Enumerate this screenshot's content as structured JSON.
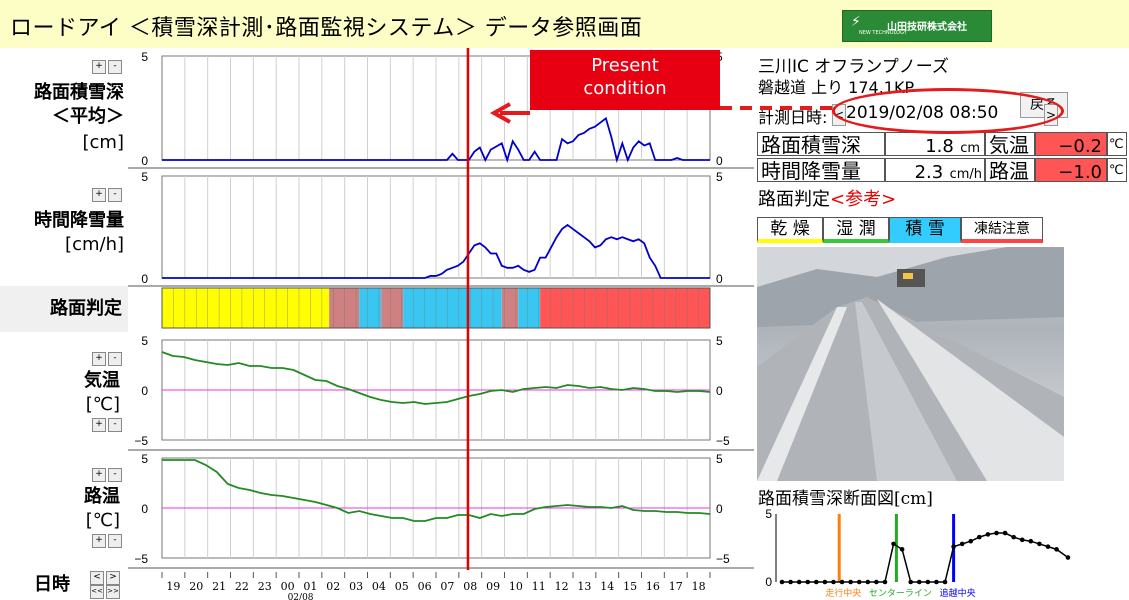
{
  "header": {
    "title": "ロードアイ ＜積雪深計測･路面監視システム＞ データ参照画面",
    "logo_text": "山田技研株式会社",
    "logo_sub": "NEW TECHNOLOGY"
  },
  "annotation": {
    "line1": "Present",
    "line2": "condition"
  },
  "labels": {
    "snow_depth_1": "路面積雪深",
    "snow_depth_2": "＜平均＞",
    "snow_depth_unit": "[cm]",
    "snowfall_1": "時間降雪量",
    "snowfall_unit": "[cm/h]",
    "surface_state": "路面判定",
    "air_temp_1": "気温",
    "air_temp_unit": "[℃]",
    "road_temp_1": "路温",
    "road_temp_unit": "[℃]",
    "datetime": "日時",
    "plus": "+",
    "minus": "-",
    "nav_prev": "<",
    "nav_next": ">",
    "nav_prev2": "<<",
    "nav_next2": ">>"
  },
  "right": {
    "location_1": "三川IC オフランプノーズ",
    "location_2": "磐越道 上り 174.1KP",
    "back_label": "戻る",
    "measure_label": "計測日時:",
    "prev_btn": "<",
    "next_btn": ">",
    "datetime": "2019/02/08 08:50",
    "snow_depth_label": "路面積雪深",
    "snow_depth_value": "1.8",
    "snow_depth_unit": "cm",
    "air_temp_label": "気温",
    "air_temp_value": "−0.2",
    "temp_unit": "℃",
    "snowfall_label": "時間降雪量",
    "snowfall_value": "2.3",
    "snowfall_unit": "cm/h",
    "road_temp_label": "路温",
    "road_temp_value": "−1.0",
    "surface_title": "路面判定",
    "surface_ref": "<参考>",
    "states": [
      {
        "label": "乾 燥",
        "color": "#ffff00"
      },
      {
        "label": "湿 潤",
        "color": "#39c83a"
      },
      {
        "label": "積 雪",
        "color": "#33ccff"
      },
      {
        "label": "凍結注意",
        "color": "#ff4444"
      }
    ],
    "cross_section_title": "路面積雪深断面図[cm]",
    "cs_labels": [
      "走行中央",
      "センターライン",
      "追越中央"
    ]
  },
  "colors": {
    "line_blue": "#0000cc",
    "line_green": "#228b22",
    "zero_magenta": "#ee33ee",
    "present_red": "#e00000",
    "state_yellow": "#ffff00",
    "state_blue": "#39c7f2",
    "state_red": "#ff5555",
    "state_mix": "#cf8080"
  },
  "chart_data": [
    {
      "type": "line",
      "name": "snow_depth",
      "ylim": [
        0,
        5
      ],
      "yticks": [
        0,
        5
      ],
      "x": [
        0,
        52,
        53,
        54,
        55,
        56,
        57,
        58,
        59,
        60,
        62,
        63,
        64,
        65,
        66,
        67,
        68,
        69,
        70,
        72,
        73,
        74,
        75,
        76,
        77,
        78,
        79,
        80,
        81,
        82,
        83,
        84,
        85,
        86,
        87,
        88,
        89,
        90,
        91,
        92,
        93,
        94,
        95,
        96,
        100
      ],
      "values": [
        0,
        0,
        0.3,
        0,
        0,
        0,
        0.4,
        0.6,
        0,
        0.5,
        0.8,
        0,
        0.9,
        0.5,
        0,
        0,
        0.4,
        0,
        0,
        0,
        1.0,
        0.8,
        0.9,
        1.2,
        1.3,
        1.5,
        1.6,
        1.8,
        2.0,
        1.1,
        0,
        0.8,
        0,
        0.6,
        0.9,
        0.7,
        0.8,
        0,
        0,
        0,
        0,
        0.1,
        0,
        0,
        0
      ]
    },
    {
      "type": "line",
      "name": "hourly_snowfall",
      "ylim": [
        0,
        5
      ],
      "yticks": [
        0,
        5
      ],
      "x": [
        0,
        48,
        49,
        50,
        51,
        52,
        53,
        54,
        55,
        56,
        57,
        58,
        59,
        60,
        61,
        62,
        63,
        64,
        65,
        66,
        67,
        68,
        69,
        70,
        71,
        72,
        73,
        74,
        75,
        76,
        77,
        78,
        79,
        80,
        81,
        82,
        83,
        84,
        85,
        86,
        87,
        88,
        89,
        90,
        91,
        92,
        93,
        94,
        95,
        96,
        97,
        100
      ],
      "values": [
        0,
        0,
        0.1,
        0.1,
        0.2,
        0.4,
        0.5,
        0.6,
        0.8,
        1.2,
        1.6,
        1.7,
        1.5,
        1.2,
        1.2,
        0.6,
        0.5,
        0.5,
        0.6,
        0.4,
        0.3,
        0.4,
        1.0,
        1.0,
        1.5,
        2.0,
        2.4,
        2.6,
        2.4,
        2.2,
        2.0,
        1.8,
        1.5,
        1.6,
        1.9,
        2.0,
        1.9,
        2.0,
        1.9,
        1.8,
        1.9,
        1.7,
        1.0,
        0.6,
        0,
        0,
        0,
        0,
        0,
        0,
        0,
        0
      ]
    },
    {
      "type": "line",
      "name": "air_temperature",
      "ylim": [
        -5,
        5
      ],
      "yticks": [
        -5,
        0,
        5
      ],
      "x": [
        0,
        2,
        4,
        6,
        8,
        10,
        12,
        14,
        16,
        18,
        20,
        22,
        24,
        26,
        28,
        30,
        32,
        34,
        36,
        38,
        40,
        42,
        44,
        46,
        48,
        50,
        52,
        54,
        56,
        58,
        60,
        62,
        64,
        66,
        68,
        70,
        72,
        74,
        76,
        78,
        80,
        82,
        84,
        86,
        88,
        90,
        92,
        94,
        96,
        98,
        100
      ],
      "values": [
        3.8,
        3.4,
        3.3,
        3.0,
        2.8,
        2.6,
        2.5,
        2.7,
        2.4,
        2.4,
        2.2,
        2.2,
        2.0,
        1.5,
        1.0,
        0.9,
        0.4,
        0.1,
        -0.3,
        -0.7,
        -1.0,
        -1.2,
        -1.3,
        -1.2,
        -1.4,
        -1.3,
        -1.2,
        -0.9,
        -0.6,
        -0.4,
        -0.1,
        0.0,
        -0.2,
        0.1,
        0.2,
        0.3,
        0.2,
        0.5,
        0.4,
        0.2,
        0.3,
        0.1,
        0.0,
        0.2,
        0.1,
        -0.1,
        -0.1,
        -0.2,
        -0.1,
        -0.1,
        -0.2
      ]
    },
    {
      "type": "line",
      "name": "road_temperature",
      "ylim": [
        -5,
        5
      ],
      "yticks": [
        -5,
        0,
        5
      ],
      "x": [
        0,
        2,
        4,
        6,
        8,
        10,
        12,
        14,
        16,
        18,
        20,
        22,
        24,
        26,
        28,
        30,
        32,
        34,
        36,
        38,
        40,
        42,
        44,
        46,
        48,
        50,
        52,
        54,
        56,
        58,
        60,
        62,
        64,
        66,
        68,
        70,
        72,
        74,
        76,
        78,
        80,
        82,
        84,
        86,
        88,
        90,
        92,
        94,
        96,
        98,
        100
      ],
      "values": [
        4.8,
        4.8,
        4.8,
        4.8,
        4.3,
        3.6,
        2.4,
        2.0,
        1.8,
        1.5,
        1.3,
        1.2,
        1.0,
        0.8,
        0.6,
        0.3,
        0.0,
        -0.5,
        -0.3,
        -0.6,
        -0.8,
        -1.0,
        -1.0,
        -1.3,
        -1.3,
        -1.0,
        -1.0,
        -0.7,
        -0.7,
        -1.0,
        -0.6,
        -0.8,
        -0.6,
        -0.6,
        -0.1,
        0.1,
        0.2,
        0.3,
        0.2,
        0.1,
        0.1,
        0.0,
        0.2,
        -0.2,
        -0.3,
        -0.3,
        -0.4,
        -0.4,
        -0.5,
        -0.5,
        -0.6
      ]
    },
    {
      "type": "heatmap",
      "name": "surface_state",
      "segments": [
        {
          "from": 0,
          "to": 30.5,
          "state": "dry"
        },
        {
          "from": 30.5,
          "to": 36,
          "state": "mix"
        },
        {
          "from": 36,
          "to": 40,
          "state": "snow"
        },
        {
          "from": 40,
          "to": 44,
          "state": "mix"
        },
        {
          "from": 44,
          "to": 62,
          "state": "snow"
        },
        {
          "from": 62,
          "to": 65,
          "state": "mix"
        },
        {
          "from": 65,
          "to": 69,
          "state": "snow"
        },
        {
          "from": 69,
          "to": 100,
          "state": "freeze"
        }
      ]
    },
    {
      "type": "line",
      "name": "cross_section",
      "ylim": [
        0,
        5
      ],
      "yticks": [
        0,
        5
      ],
      "x": [
        0,
        3,
        6,
        9,
        12,
        15,
        18,
        21,
        24,
        27,
        30,
        33,
        36,
        39,
        42,
        45,
        48,
        51,
        54,
        57,
        60,
        63,
        66,
        69,
        72,
        75,
        78,
        81,
        84,
        87,
        90,
        93,
        96,
        100
      ],
      "values": [
        0,
        0,
        0,
        0,
        0,
        0,
        0,
        0,
        0,
        0,
        0,
        0,
        0,
        2.8,
        2.4,
        0,
        0,
        0,
        0,
        0,
        2.6,
        2.8,
        3.0,
        3.3,
        3.5,
        3.6,
        3.6,
        3.3,
        3.1,
        3.0,
        2.8,
        2.6,
        2.4,
        1.8
      ],
      "markers": [
        {
          "x": 20,
          "color": "#ff7f0e"
        },
        {
          "x": 40,
          "color": "#22aa22"
        },
        {
          "x": 60,
          "color": "#0000ff"
        }
      ]
    }
  ],
  "time_axis": {
    "labels": [
      "19",
      "20",
      "21",
      "22",
      "23",
      "00",
      "01",
      "02",
      "03",
      "04",
      "05",
      "06",
      "07",
      "08",
      "09",
      "10",
      "11",
      "12",
      "13",
      "14",
      "15",
      "16",
      "17",
      "18"
    ],
    "date_label": "02/08",
    "present_index": 13.4
  }
}
